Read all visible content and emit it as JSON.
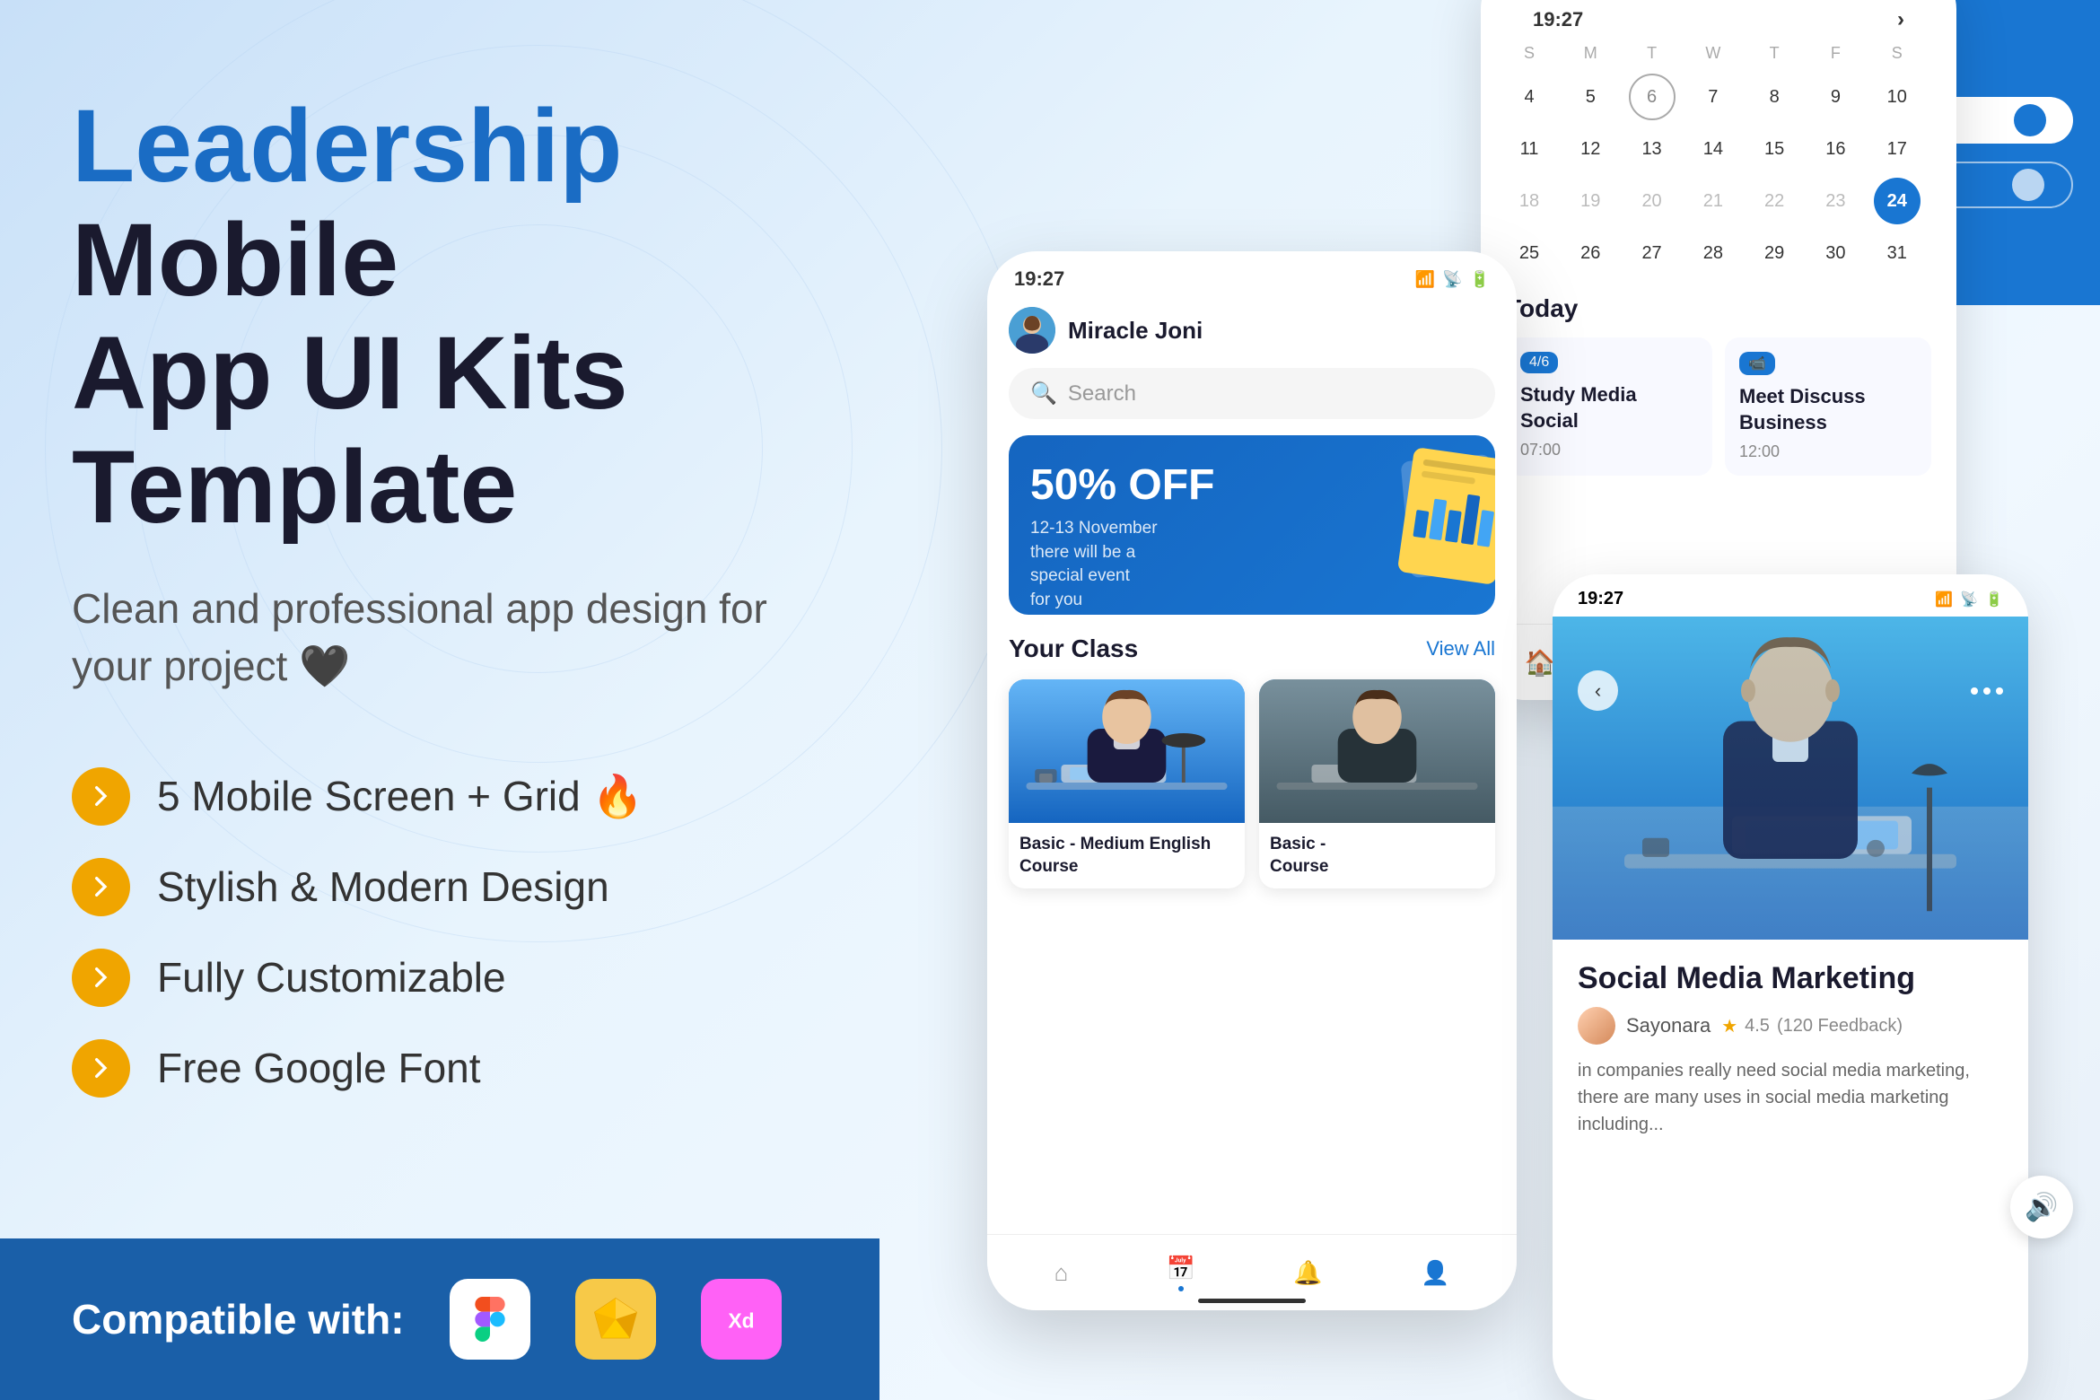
{
  "page": {
    "background": "gradient"
  },
  "header": {
    "title_blue": "Leadership",
    "title_dark": " Mobile\nApp UI Kits Template"
  },
  "subtitle": "Clean and professional\napp design for your project 🖤",
  "features": [
    {
      "id": 1,
      "text": "5 Mobile Screen + Grid 🔥"
    },
    {
      "id": 2,
      "text": "Stylish & Modern Design"
    },
    {
      "id": 3,
      "text": "Fully Customizable"
    },
    {
      "id": 4,
      "text": "Free Google Font"
    }
  ],
  "compatible": {
    "label": "Compatible with:",
    "tools": [
      "figma",
      "sketch",
      "xd"
    ]
  },
  "phone_main": {
    "status_time": "19:27",
    "user_name": "Miracle Joni",
    "search_placeholder": "Search",
    "promo": {
      "discount": "50% OFF",
      "date": "12-13 November\nthere will be a\nspecial event\nfor you"
    },
    "your_class": {
      "title": "Your Class",
      "view_all": "View All"
    },
    "courses": [
      {
        "title": "Basic - Medium English\nCourse"
      },
      {
        "title": "Basic -\nCourse"
      }
    ]
  },
  "phone_calendar": {
    "status_time": "19:27",
    "month": {
      "rows": [
        [
          4,
          5,
          6,
          7,
          8,
          9,
          10
        ],
        [
          11,
          12,
          13,
          14,
          15,
          16,
          17
        ],
        [
          18,
          19,
          20,
          21,
          22,
          23,
          24
        ],
        [
          25,
          26,
          27,
          28,
          29,
          30,
          31
        ]
      ],
      "today": 24,
      "circle": 6
    },
    "today_section": {
      "label": "Today",
      "cards": [
        {
          "badge": "4/6",
          "title": "Study\nMedia Social",
          "time": "07:00"
        },
        {
          "badge": "video",
          "title": "Meet Discuss\nBusiness",
          "time": "12:00"
        }
      ]
    }
  },
  "phone_detail": {
    "status_time": "19:27",
    "course_title": "Social Media Marketing",
    "author": "Sayonara",
    "rating": "4.5",
    "feedback": "(120 Feedback)",
    "description": "in companies really need social media marketing, there are many uses in social media marketing including..."
  },
  "colors": {
    "blue": "#1976d2",
    "dark_blue": "#1a1a2e",
    "yellow": "#f0a500",
    "light_bg": "#e8f4fd",
    "white": "#ffffff"
  }
}
